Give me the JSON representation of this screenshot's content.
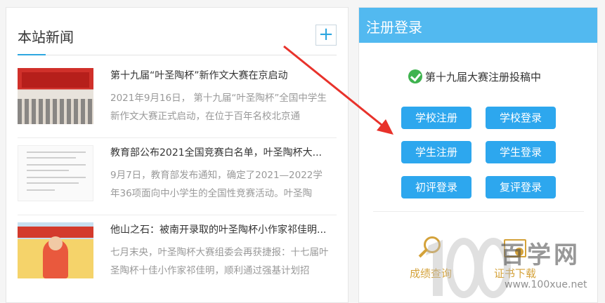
{
  "news": {
    "title": "本站新闻",
    "more_label": "+",
    "items": [
      {
        "title": "第十九届“叶圣陶杯”新作文大赛在京启动",
        "desc": "2021年9月16日， 第十九届“叶圣陶杯”全国中学生新作文大赛正式启动，在位于百年名校北京通"
      },
      {
        "title": "教育部公布2021全国竞赛白名单，叶圣陶杯大...",
        "desc": "9月7日，教育部发布通知，确定了2021—2022学年36项面向中小学生的全国性竞赛活动。叶圣陶"
      },
      {
        "title": "他山之石：被南开录取的叶圣陶杯小作家祁佳明...",
        "desc": "七月末央，叶圣陶杯大赛组委会再获捷报：十七届叶圣陶杯十佳小作家祁佳明，顺利通过强基计划招"
      }
    ]
  },
  "register": {
    "title": "注册登录",
    "status": "第十九届大赛注册投稿中",
    "buttons": {
      "school_register": "学校注册",
      "school_login": "学校登录",
      "student_register": "学生注册",
      "student_login": "学生登录",
      "first_review_login": "初评登录",
      "second_review_login": "复评登录"
    },
    "utilities": {
      "score_query": "成绩查询",
      "certificate_download": "证书下载"
    }
  },
  "watermark": {
    "text": "百学网",
    "url": "www.100xue.net"
  },
  "colors": {
    "accent": "#2da7ee",
    "header_blue": "#52b9f0",
    "gold": "#d4a23a",
    "arrow_red": "#e8322b"
  }
}
